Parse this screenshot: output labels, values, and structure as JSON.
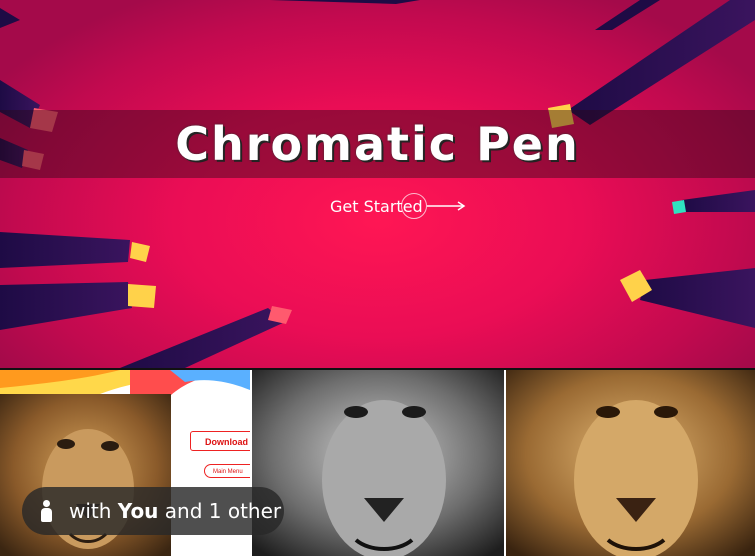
{
  "hero": {
    "title": "Chromatic Pen",
    "cta_label": "Get Started",
    "colors": {
      "background": "#ea0d55",
      "ray": "#2a1150",
      "band": "#280816"
    }
  },
  "thumbnails": [
    {
      "name": "landing-page-preview",
      "download_label": "Download",
      "main_menu_label": "Main Menu"
    },
    {
      "name": "lion-grayscale"
    },
    {
      "name": "lion-color"
    }
  ],
  "presence": {
    "prefix": "with",
    "you": "You",
    "suffix": "and 1 other"
  }
}
